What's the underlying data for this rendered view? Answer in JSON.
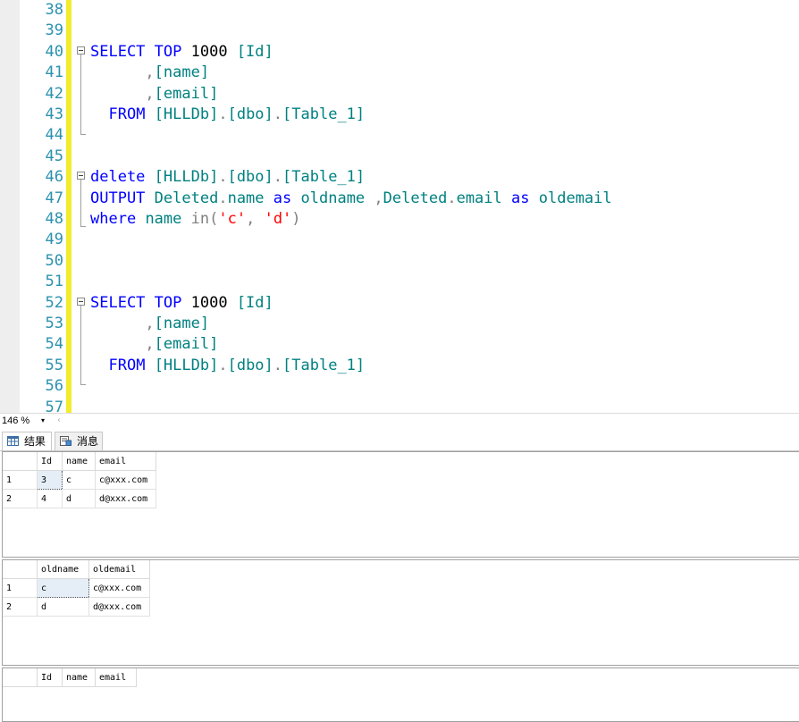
{
  "editor": {
    "lines": [
      {
        "num": "38",
        "tokens": []
      },
      {
        "num": "39",
        "tokens": []
      },
      {
        "num": "40",
        "tokens": [
          {
            "t": "SELECT",
            "c": "kw"
          },
          {
            "t": " "
          },
          {
            "t": "TOP",
            "c": "kw"
          },
          {
            "t": " 1000 "
          },
          {
            "t": "[Id]",
            "c": "obj"
          }
        ]
      },
      {
        "num": "41",
        "tokens": [
          {
            "t": "      "
          },
          {
            "t": ",",
            "c": "gray"
          },
          {
            "t": "[name]",
            "c": "obj"
          }
        ]
      },
      {
        "num": "42",
        "tokens": [
          {
            "t": "      "
          },
          {
            "t": ",",
            "c": "gray"
          },
          {
            "t": "[email]",
            "c": "obj"
          }
        ]
      },
      {
        "num": "43",
        "tokens": [
          {
            "t": "  "
          },
          {
            "t": "FROM",
            "c": "kw"
          },
          {
            "t": " "
          },
          {
            "t": "[HLLDb]",
            "c": "obj"
          },
          {
            "t": ".",
            "c": "gray"
          },
          {
            "t": "[dbo]",
            "c": "obj"
          },
          {
            "t": ".",
            "c": "gray"
          },
          {
            "t": "[Table_1]",
            "c": "obj"
          }
        ]
      },
      {
        "num": "44",
        "tokens": []
      },
      {
        "num": "45",
        "tokens": []
      },
      {
        "num": "46",
        "tokens": [
          {
            "t": "delete",
            "c": "kw"
          },
          {
            "t": " "
          },
          {
            "t": "[HLLDb]",
            "c": "obj"
          },
          {
            "t": ".",
            "c": "gray"
          },
          {
            "t": "[dbo]",
            "c": "obj"
          },
          {
            "t": ".",
            "c": "gray"
          },
          {
            "t": "[Table_1]",
            "c": "obj"
          }
        ]
      },
      {
        "num": "47",
        "tokens": [
          {
            "t": "OUTPUT",
            "c": "kw"
          },
          {
            "t": " "
          },
          {
            "t": "Deleted",
            "c": "obj"
          },
          {
            "t": ".",
            "c": "gray"
          },
          {
            "t": "name",
            "c": "obj"
          },
          {
            "t": " "
          },
          {
            "t": "as",
            "c": "kw"
          },
          {
            "t": " "
          },
          {
            "t": "oldname",
            "c": "obj"
          },
          {
            "t": " "
          },
          {
            "t": ",",
            "c": "gray"
          },
          {
            "t": "Deleted",
            "c": "obj"
          },
          {
            "t": ".",
            "c": "gray"
          },
          {
            "t": "email",
            "c": "obj"
          },
          {
            "t": " "
          },
          {
            "t": "as",
            "c": "kw"
          },
          {
            "t": " "
          },
          {
            "t": "oldemail",
            "c": "obj"
          }
        ]
      },
      {
        "num": "48",
        "tokens": [
          {
            "t": "where",
            "c": "kw"
          },
          {
            "t": " "
          },
          {
            "t": "name",
            "c": "obj"
          },
          {
            "t": " "
          },
          {
            "t": "in(",
            "c": "gray"
          },
          {
            "t": "'c'",
            "c": "str"
          },
          {
            "t": ",",
            "c": "gray"
          },
          {
            "t": " "
          },
          {
            "t": "'d'",
            "c": "str"
          },
          {
            "t": ")",
            "c": "gray"
          }
        ]
      },
      {
        "num": "49",
        "tokens": []
      },
      {
        "num": "50",
        "tokens": []
      },
      {
        "num": "51",
        "tokens": []
      },
      {
        "num": "52",
        "tokens": [
          {
            "t": "SELECT",
            "c": "kw"
          },
          {
            "t": " "
          },
          {
            "t": "TOP",
            "c": "kw"
          },
          {
            "t": " 1000 "
          },
          {
            "t": "[Id]",
            "c": "obj"
          }
        ]
      },
      {
        "num": "53",
        "tokens": [
          {
            "t": "      "
          },
          {
            "t": ",",
            "c": "gray"
          },
          {
            "t": "[name]",
            "c": "obj"
          }
        ]
      },
      {
        "num": "54",
        "tokens": [
          {
            "t": "      "
          },
          {
            "t": ",",
            "c": "gray"
          },
          {
            "t": "[email]",
            "c": "obj"
          }
        ]
      },
      {
        "num": "55",
        "tokens": [
          {
            "t": "  "
          },
          {
            "t": "FROM",
            "c": "kw"
          },
          {
            "t": " "
          },
          {
            "t": "[HLLDb]",
            "c": "obj"
          },
          {
            "t": ".",
            "c": "gray"
          },
          {
            "t": "[dbo]",
            "c": "obj"
          },
          {
            "t": ".",
            "c": "gray"
          },
          {
            "t": "[Table_1]",
            "c": "obj"
          }
        ]
      },
      {
        "num": "56",
        "tokens": []
      },
      {
        "num": "57",
        "tokens": []
      }
    ],
    "colors": {
      "keyword": "#0000ff",
      "identifier": "#008080",
      "string": "#ff0000",
      "operator": "#808080",
      "line_number": "#2b91af",
      "change_bar": "#f2ec2e"
    }
  },
  "status": {
    "zoom": "146 %",
    "zoom_dropdown_icon": "▾",
    "scroll_left_icon": "‹"
  },
  "tabs": {
    "results": {
      "label": "结果",
      "icon": "grid-icon"
    },
    "messages": {
      "label": "消息",
      "icon": "message-icon"
    }
  },
  "grids": [
    {
      "columns": [
        "Id",
        "name",
        "email"
      ],
      "rows": [
        [
          "1",
          "3",
          "c",
          "c@xxx.com"
        ],
        [
          "2",
          "4",
          "d",
          "d@xxx.com"
        ]
      ]
    },
    {
      "columns": [
        "oldname",
        "oldemail"
      ],
      "rows": [
        [
          "1",
          "c",
          "c@xxx.com"
        ],
        [
          "2",
          "d",
          "d@xxx.com"
        ]
      ]
    },
    {
      "columns": [
        "Id",
        "name",
        "email"
      ],
      "rows": []
    }
  ]
}
